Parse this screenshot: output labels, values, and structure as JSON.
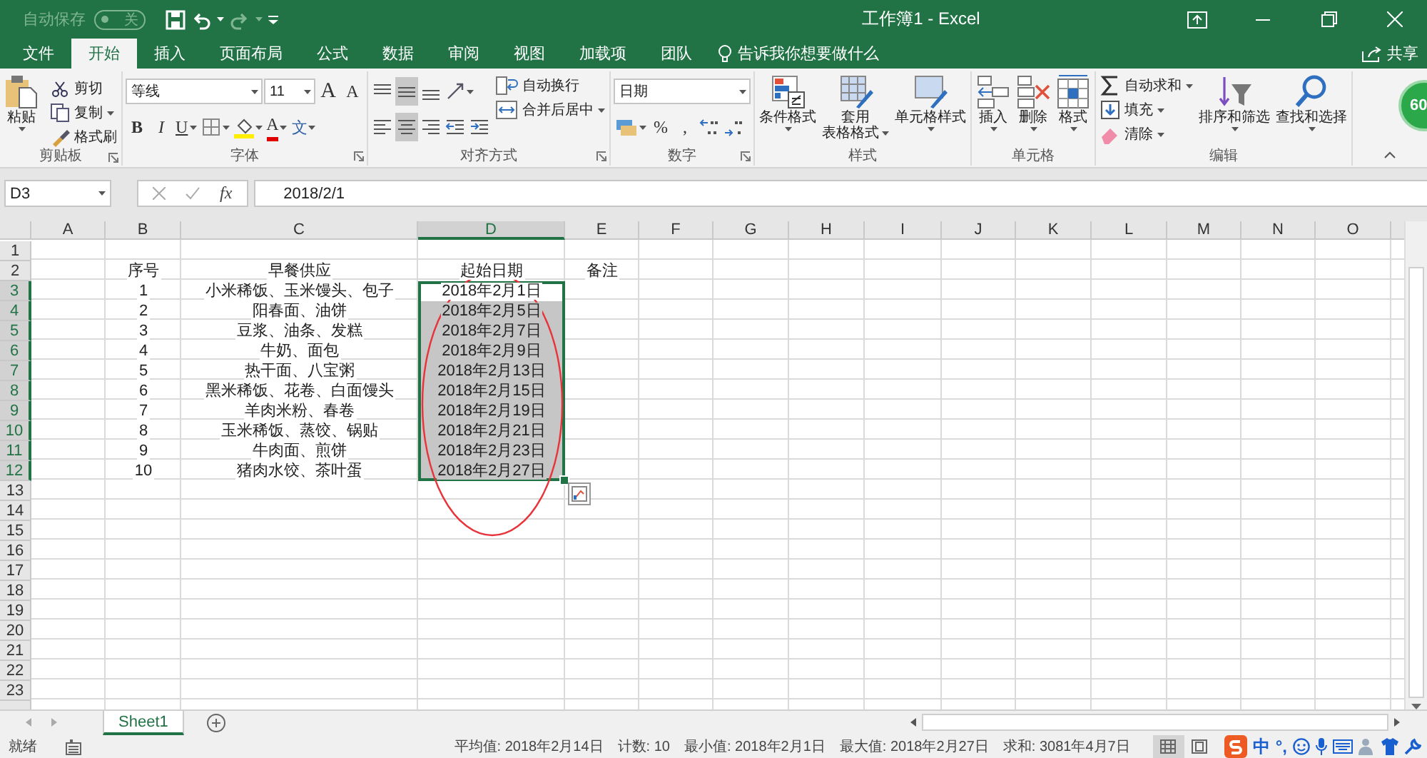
{
  "title_bar": {
    "autosave": {
      "label": "自动保存",
      "on": false,
      "state_text": "关"
    },
    "title": "工作簿1  -  Excel"
  },
  "tabs": [
    {
      "label": "文件",
      "selected": false
    },
    {
      "label": "开始",
      "selected": true
    },
    {
      "label": "插入",
      "selected": false
    },
    {
      "label": "页面布局",
      "selected": false
    },
    {
      "label": "公式",
      "selected": false
    },
    {
      "label": "数据",
      "selected": false
    },
    {
      "label": "审阅",
      "selected": false
    },
    {
      "label": "视图",
      "selected": false
    },
    {
      "label": "加载项",
      "selected": false
    },
    {
      "label": "团队",
      "selected": false
    }
  ],
  "tell_me": "告诉我你想要做什么",
  "share": "共享",
  "ribbon": {
    "groups": [
      {
        "title": "剪贴板",
        "launcher": true,
        "items": [
          {
            "kind": "large",
            "label": "粘贴",
            "menu": true
          },
          {
            "kind": "stack",
            "items": [
              {
                "kind": "small",
                "label": "剪切",
                "menu": false
              },
              {
                "kind": "small",
                "label": "复制",
                "menu": true
              },
              {
                "kind": "small",
                "label": "格式刷",
                "menu": false
              }
            ]
          }
        ]
      },
      {
        "title": "字体",
        "launcher": true,
        "items": [
          {
            "kind": "stack",
            "items": [
              {
                "kind": "tools",
                "items": [
                  {
                    "kind": "field",
                    "value": "等线"
                  },
                  {
                    "kind": "field",
                    "value": "11"
                  },
                  {
                    "kind": "grow",
                    "text": "A",
                    "menu": false
                  },
                  {
                    "kind": "shrink",
                    "text": "A",
                    "menu": false
                  }
                ]
              },
              {
                "kind": "tools",
                "items": [
                  {
                    "kind": "bold",
                    "text": "B",
                    "menu": false
                  },
                  {
                    "kind": "italic",
                    "text": "I",
                    "menu": false
                  },
                  {
                    "kind": "underline",
                    "text": "U",
                    "menu": true
                  },
                  {
                    "kind": "icon",
                    "menu": true
                  },
                  {
                    "kind": "icon",
                    "menu": true
                  },
                  {
                    "kind": "font-color",
                    "text": "A",
                    "menu": true
                  },
                  {
                    "kind": "phonetic",
                    "text": "文",
                    "menu": true
                  }
                ]
              }
            ]
          }
        ]
      },
      {
        "title": "对齐方式",
        "launcher": true,
        "items": [
          {
            "kind": "stack",
            "items": [
              {
                "kind": "tools",
                "items": [
                  {
                    "kind": "icon",
                    "on": false,
                    "menu": false
                  },
                  {
                    "kind": "icon",
                    "on": true,
                    "menu": false
                  },
                  {
                    "kind": "icon",
                    "on": false,
                    "menu": false
                  },
                  {
                    "kind": "icon",
                    "on": false,
                    "menu": true
                  }
                ]
              },
              {
                "kind": "tools",
                "items": [
                  {
                    "kind": "icon",
                    "on": false,
                    "menu": false
                  },
                  {
                    "kind": "icon",
                    "on": true,
                    "menu": false
                  },
                  {
                    "kind": "icon",
                    "on": false,
                    "menu": false
                  },
                  {
                    "kind": "icon",
                    "on": false,
                    "menu": false
                  },
                  {
                    "kind": "icon",
                    "on": false,
                    "menu": false
                  }
                ]
              }
            ]
          },
          {
            "kind": "stack",
            "items": [
              {
                "kind": "small",
                "label": "自动换行",
                "menu": false
              },
              {
                "kind": "small",
                "label": "合并后居中",
                "menu": true
              }
            ]
          }
        ]
      },
      {
        "title": "数字",
        "launcher": true,
        "items": [
          {
            "kind": "stack",
            "items": [
              {
                "kind": "tools",
                "items": [
                  {
                    "kind": "field",
                    "value": "日期"
                  }
                ]
              },
              {
                "kind": "tools",
                "items": [
                  {
                    "kind": "icon",
                    "menu": true
                  },
                  {
                    "kind": "percent",
                    "text": "%",
                    "menu": false
                  },
                  {
                    "kind": "comma",
                    "text": ",",
                    "menu": false
                  },
                  {
                    "kind": "icon",
                    "menu": false
                  },
                  {
                    "kind": "icon",
                    "menu": false
                  }
                ]
              }
            ]
          }
        ]
      },
      {
        "title": "样式",
        "launcher": false,
        "items": [
          {
            "kind": "large",
            "label": "条件格式",
            "menu": true
          },
          {
            "kind": "large",
            "label_lines": [
              "套用",
              "表格格式"
            ],
            "menu": true
          },
          {
            "kind": "large",
            "label": "单元格样式",
            "menu": true
          }
        ]
      },
      {
        "title": "单元格",
        "launcher": false,
        "items": [
          {
            "kind": "large",
            "label": "插入",
            "menu": true
          },
          {
            "kind": "large",
            "label": "删除",
            "menu": true
          },
          {
            "kind": "large",
            "label": "格式",
            "menu": true
          }
        ]
      },
      {
        "title": "编辑",
        "launcher": false,
        "items": [
          {
            "kind": "stack",
            "items": [
              {
                "kind": "small",
                "label": "自动求和",
                "menu": true
              },
              {
                "kind": "small",
                "label": "填充",
                "menu": true
              },
              {
                "kind": "small",
                "label": "清除",
                "menu": true
              }
            ]
          },
          {
            "kind": "large",
            "label": "排序和筛选",
            "menu": true
          },
          {
            "kind": "large",
            "label": "查找和选择",
            "menu": true
          }
        ]
      }
    ]
  },
  "floating_badge": "60",
  "formula_bar": {
    "name_box": "D3",
    "function_button": "fx",
    "formula": "2018/2/1"
  },
  "grid": {
    "columns": [
      {
        "label": "A",
        "selected": false
      },
      {
        "label": "B",
        "selected": false
      },
      {
        "label": "C",
        "selected": false
      },
      {
        "label": "D",
        "selected": true
      },
      {
        "label": "E",
        "selected": false
      },
      {
        "label": "F",
        "selected": false
      },
      {
        "label": "G",
        "selected": false
      },
      {
        "label": "H",
        "selected": false
      },
      {
        "label": "I",
        "selected": false
      },
      {
        "label": "J",
        "selected": false
      },
      {
        "label": "K",
        "selected": false
      },
      {
        "label": "L",
        "selected": false
      },
      {
        "label": "M",
        "selected": false
      },
      {
        "label": "N",
        "selected": false
      },
      {
        "label": "O",
        "selected": false
      }
    ],
    "rows": [
      {
        "number": "1",
        "selected": false
      },
      {
        "number": "2",
        "selected": false,
        "cells": [
          "",
          "序号",
          "早餐供应",
          "起始日期",
          "备注"
        ]
      },
      {
        "number": "3",
        "selected": true,
        "cells": [
          "",
          "1",
          "小米稀饭、玉米馒头、包子",
          "2018年2月1日"
        ]
      },
      {
        "number": "4",
        "selected": true,
        "cells": [
          "",
          "2",
          "阳春面、油饼",
          "2018年2月5日"
        ]
      },
      {
        "number": "5",
        "selected": true,
        "cells": [
          "",
          "3",
          "豆浆、油条、发糕",
          "2018年2月7日"
        ]
      },
      {
        "number": "6",
        "selected": true,
        "cells": [
          "",
          "4",
          "牛奶、面包",
          "2018年2月9日"
        ]
      },
      {
        "number": "7",
        "selected": true,
        "cells": [
          "",
          "5",
          "热干面、八宝粥",
          "2018年2月13日"
        ]
      },
      {
        "number": "8",
        "selected": true,
        "cells": [
          "",
          "6",
          "黑米稀饭、花卷、白面馒头",
          "2018年2月15日"
        ]
      },
      {
        "number": "9",
        "selected": true,
        "cells": [
          "",
          "7",
          "羊肉米粉、春卷",
          "2018年2月19日"
        ]
      },
      {
        "number": "10",
        "selected": true,
        "cells": [
          "",
          "8",
          "玉米稀饭、蒸饺、锅贴",
          "2018年2月21日"
        ]
      },
      {
        "number": "11",
        "selected": true,
        "cells": [
          "",
          "9",
          "牛肉面、煎饼",
          "2018年2月23日"
        ]
      },
      {
        "number": "12",
        "selected": true,
        "cells": [
          "",
          "10",
          "猪肉水饺、茶叶蛋",
          "2018年2月27日"
        ]
      },
      {
        "number": "13",
        "selected": false
      },
      {
        "number": "14",
        "selected": false
      },
      {
        "number": "15",
        "selected": false
      },
      {
        "number": "16",
        "selected": false
      },
      {
        "number": "17",
        "selected": false
      },
      {
        "number": "18",
        "selected": false
      },
      {
        "number": "19",
        "selected": false
      },
      {
        "number": "20",
        "selected": false
      },
      {
        "number": "21",
        "selected": false
      },
      {
        "number": "22",
        "selected": false
      },
      {
        "number": "23",
        "selected": false
      }
    ]
  },
  "sheet_tabs": [
    {
      "label": "Sheet1",
      "selected": true
    }
  ],
  "status_bar": {
    "mode": "就绪",
    "stats": [
      "平均值: 2018年2月14日",
      "计数: 10",
      "最小值: 2018年2月1日",
      "最大值: 2018年2月27日",
      "求和: 3081年4月7日"
    ],
    "views": [
      {
        "selected": true
      },
      {
        "selected": false
      }
    ],
    "ime": {
      "language": "中",
      "punctuation": "°,"
    }
  }
}
